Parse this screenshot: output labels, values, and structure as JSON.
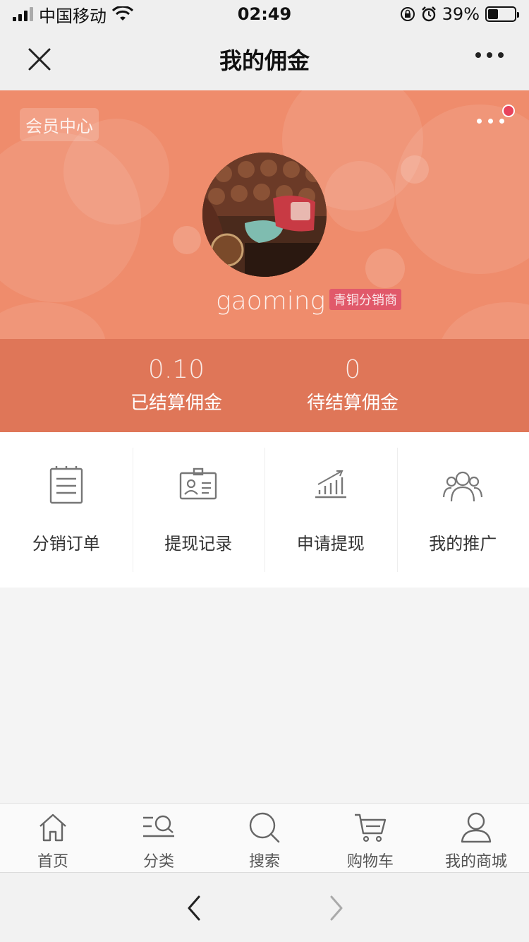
{
  "status_bar": {
    "carrier": "中国移动",
    "time": "02:49",
    "battery": "39%",
    "battery_level": 0.39
  },
  "nav": {
    "title": "我的佣金"
  },
  "hero": {
    "member_center": "会员中心",
    "username": "gaoming",
    "level": "青铜分销商",
    "bg_color": "#ef8c6c",
    "stats_bg_color": "#df7658",
    "stats": [
      {
        "value": "0.10",
        "label": "已结算佣金"
      },
      {
        "value": "0",
        "label": "待结算佣金"
      }
    ]
  },
  "menu": [
    {
      "label": "分销订单",
      "icon": "document-list-icon"
    },
    {
      "label": "提现记录",
      "icon": "id-card-icon"
    },
    {
      "label": "申请提现",
      "icon": "bar-chart-icon"
    },
    {
      "label": "我的推广",
      "icon": "group-users-icon"
    }
  ],
  "tabbar": [
    {
      "label": "首页",
      "icon": "home-icon"
    },
    {
      "label": "分类",
      "icon": "category-search-icon"
    },
    {
      "label": "搜索",
      "icon": "search-icon"
    },
    {
      "label": "购物车",
      "icon": "cart-icon"
    },
    {
      "label": "我的商城",
      "icon": "user-icon"
    }
  ]
}
